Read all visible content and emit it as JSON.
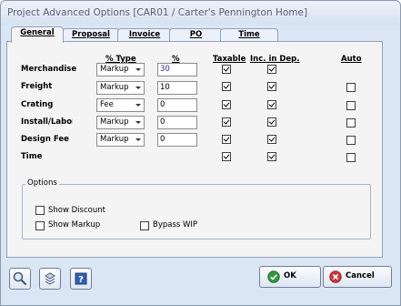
{
  "window": {
    "title": "Project Advanced Options [CAR01 / Carter's Pennington Home]"
  },
  "tabs": [
    {
      "label": "General",
      "active": true
    },
    {
      "label": "Proposal",
      "active": false
    },
    {
      "label": "Invoice",
      "active": false
    },
    {
      "label": "PO",
      "active": false
    },
    {
      "label": "Time",
      "active": false
    }
  ],
  "headers": {
    "pct_type": "% Type",
    "pct": "%",
    "taxable": "Taxable",
    "inc_in_dep": "Inc. in Dep.",
    "auto": "Auto"
  },
  "rows": [
    {
      "label": "Merchandise",
      "type": "Markup",
      "percent": "30",
      "taxable": true,
      "inc_in_dep": true,
      "auto": null
    },
    {
      "label": "Freight",
      "type": "Markup",
      "percent": "10",
      "taxable": true,
      "inc_in_dep": true,
      "auto": false
    },
    {
      "label": "Crating",
      "type": "Fee",
      "percent": "0",
      "taxable": true,
      "inc_in_dep": true,
      "auto": false
    },
    {
      "label": "Install/Labor",
      "type": "Markup",
      "percent": "0",
      "taxable": true,
      "inc_in_dep": true,
      "auto": false
    },
    {
      "label": "Design Fee",
      "type": "Markup",
      "percent": "0",
      "taxable": true,
      "inc_in_dep": true,
      "auto": false
    },
    {
      "label": "Time",
      "type": null,
      "percent": null,
      "taxable": true,
      "inc_in_dep": true,
      "auto": false
    }
  ],
  "options": {
    "title": "Options",
    "show_discount": {
      "label": "Show Discount",
      "checked": false
    },
    "show_markup": {
      "label": "Show Markup",
      "checked": false
    },
    "bypass_wip": {
      "label": "Bypass WIP",
      "checked": false
    }
  },
  "buttons": {
    "ok": "OK",
    "cancel": "Cancel"
  },
  "icons": [
    "search-icon",
    "link-icon",
    "help-icon",
    "check-icon",
    "cancel-icon"
  ]
}
